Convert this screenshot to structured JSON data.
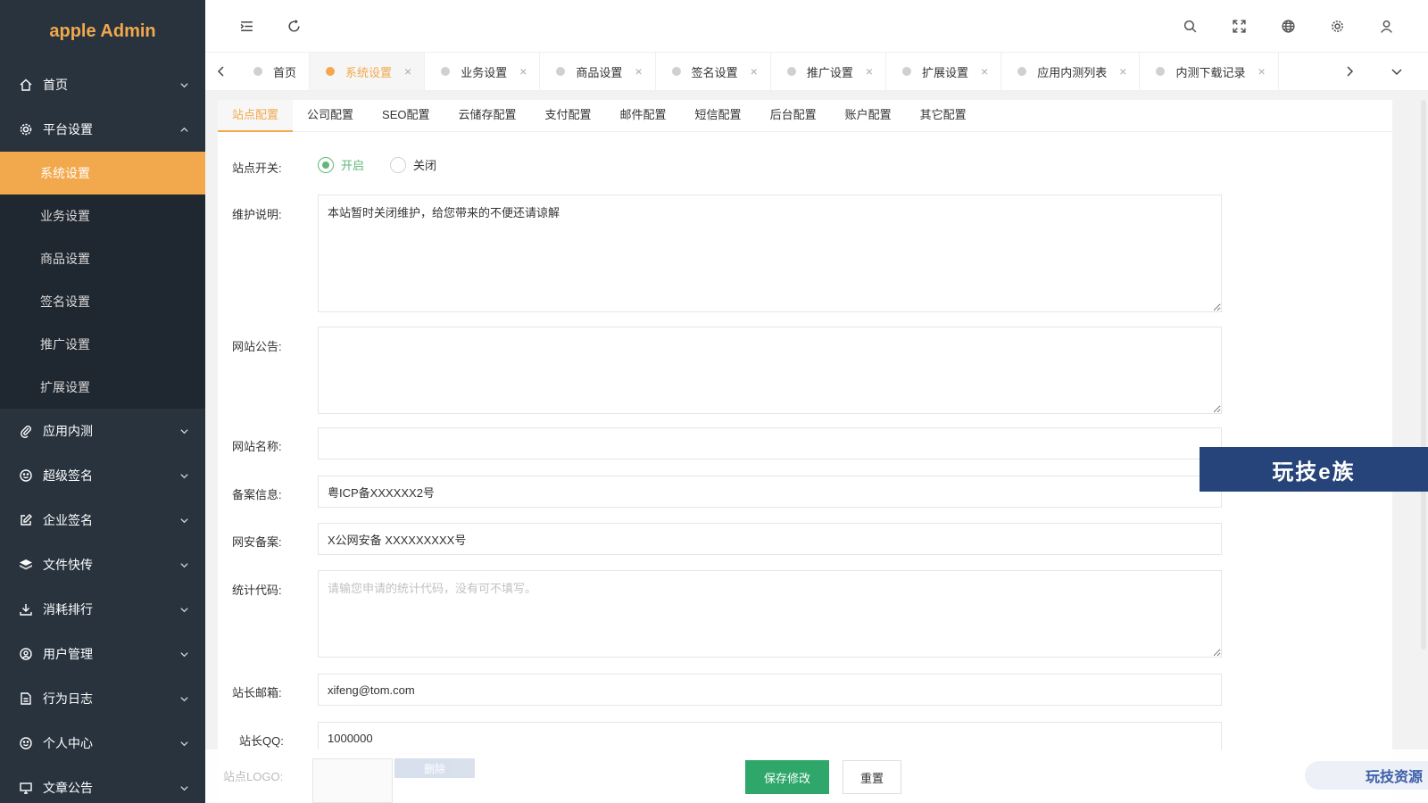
{
  "app": {
    "title": "apple Admin"
  },
  "sidebar": {
    "items": [
      {
        "label": "首页",
        "icon": "home-icon"
      },
      {
        "label": "平台设置",
        "icon": "gear-icon",
        "expanded": true,
        "children": [
          {
            "label": "系统设置",
            "active": true
          },
          {
            "label": "业务设置"
          },
          {
            "label": "商品设置"
          },
          {
            "label": "签名设置"
          },
          {
            "label": "推广设置"
          },
          {
            "label": "扩展设置"
          }
        ]
      },
      {
        "label": "应用内测",
        "icon": "paperclip-icon"
      },
      {
        "label": "超级签名",
        "icon": "smile-icon"
      },
      {
        "label": "企业签名",
        "icon": "edit-icon"
      },
      {
        "label": "文件快传",
        "icon": "layers-icon"
      },
      {
        "label": "消耗排行",
        "icon": "download-icon"
      },
      {
        "label": "用户管理",
        "icon": "user-circle-icon"
      },
      {
        "label": "行为日志",
        "icon": "document-icon"
      },
      {
        "label": "个人中心",
        "icon": "face-icon"
      },
      {
        "label": "文章公告",
        "icon": "monitor-icon"
      }
    ]
  },
  "tabs": [
    {
      "label": "首页",
      "closable": false,
      "active": false
    },
    {
      "label": "系统设置",
      "closable": true,
      "active": true
    },
    {
      "label": "业务设置",
      "closable": true,
      "active": false
    },
    {
      "label": "商品设置",
      "closable": true,
      "active": false
    },
    {
      "label": "签名设置",
      "closable": true,
      "active": false
    },
    {
      "label": "推广设置",
      "closable": true,
      "active": false
    },
    {
      "label": "扩展设置",
      "closable": true,
      "active": false
    },
    {
      "label": "应用内测列表",
      "closable": true,
      "active": false
    },
    {
      "label": "内测下载记录",
      "closable": true,
      "active": false
    }
  ],
  "subtabs": [
    "站点配置",
    "公司配置",
    "SEO配置",
    "云储存配置",
    "支付配置",
    "邮件配置",
    "短信配置",
    "后台配置",
    "账户配置",
    "其它配置"
  ],
  "form": {
    "site_switch": {
      "label": "站点开关:",
      "on": "开启",
      "off": "关闭",
      "value": "on"
    },
    "maintenance": {
      "label": "维护说明:",
      "value": "本站暂时关闭维护，给您带来的不便还请谅解"
    },
    "notice": {
      "label": "网站公告:",
      "value": ""
    },
    "site_name": {
      "label": "网站名称:",
      "value": ""
    },
    "icp": {
      "label": "备案信息:",
      "value": "粤ICP备XXXXXX2号"
    },
    "police": {
      "label": "网安备案:",
      "value": "X公网安备 XXXXXXXXX号"
    },
    "stats": {
      "label": "统计代码:",
      "placeholder": "请输您申请的统计代码，没有可不填写。"
    },
    "email": {
      "label": "站长邮箱:",
      "value": "xifeng@tom.com"
    },
    "qq": {
      "label": "站长QQ:",
      "value": "1000000"
    },
    "logo": {
      "label": "站点LOGO:",
      "delete": "删除"
    }
  },
  "actions": {
    "save": "保存修改",
    "reset": "重置"
  },
  "watermarks": {
    "main": "玩技e族",
    "corner": "玩技资源"
  }
}
